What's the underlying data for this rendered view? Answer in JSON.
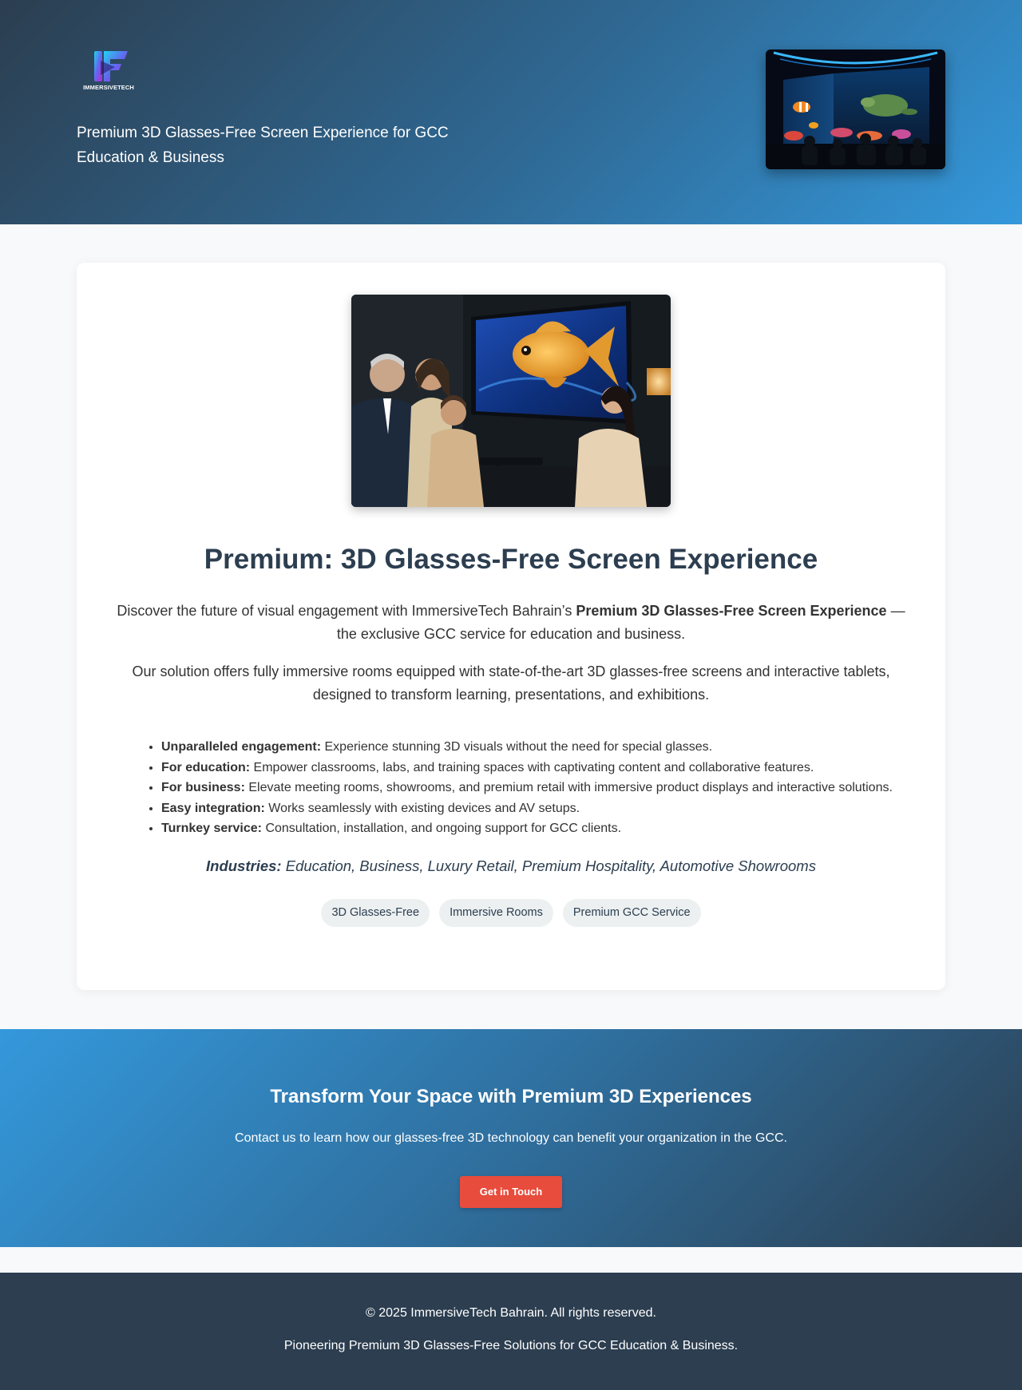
{
  "header": {
    "logo_text": "IMMERSIVETECH",
    "tagline": "Premium 3D Glasses-Free Screen Experience for GCC Education & Business"
  },
  "main": {
    "title": "Premium: 3D Glasses-Free Screen Experience",
    "intro_before": "Discover the future of visual engagement with ImmersiveTech Bahrain’s ",
    "intro_bold": "Premium 3D Glasses-Free Screen Experience",
    "intro_after": " — the exclusive GCC service for education and business.",
    "intro2": "Our solution offers fully immersive rooms equipped with state-of-the-art 3D glasses-free screens and interactive tablets, designed to transform learning, presentations, and exhibitions.",
    "features": [
      {
        "label": "Unparalleled engagement:",
        "text": " Experience stunning 3D visuals without the need for special glasses."
      },
      {
        "label": "For education:",
        "text": " Empower classrooms, labs, and training spaces with captivating content and collaborative features."
      },
      {
        "label": "For business:",
        "text": " Elevate meeting rooms, showrooms, and premium retail with immersive product displays and interactive solutions."
      },
      {
        "label": "Easy integration:",
        "text": " Works seamlessly with existing devices and AV setups."
      },
      {
        "label": "Turnkey service:",
        "text": " Consultation, installation, and ongoing support for GCC clients."
      }
    ],
    "industries_label": "Industries:",
    "industries_text": " Education, Business, Luxury Retail, Premium Hospitality, Automotive Showrooms",
    "tags": [
      "3D Glasses-Free",
      "Immersive Rooms",
      "Premium GCC Service"
    ]
  },
  "cta": {
    "title": "Transform Your Space with Premium 3D Experiences",
    "text": "Contact us to learn how our glasses-free 3D technology can benefit your organization in the GCC.",
    "button_label": "Get in Touch"
  },
  "footer": {
    "copyright": "© 2025 ImmersiveTech Bahrain. All rights reserved.",
    "tagline": "Pioneering Premium 3D Glasses-Free Solutions for GCC Education & Business."
  },
  "colors": {
    "primary_dark": "#2c3e50",
    "primary_blue": "#3498db",
    "accent_red": "#e74c3c",
    "tag_bg": "#ecf0f1"
  }
}
